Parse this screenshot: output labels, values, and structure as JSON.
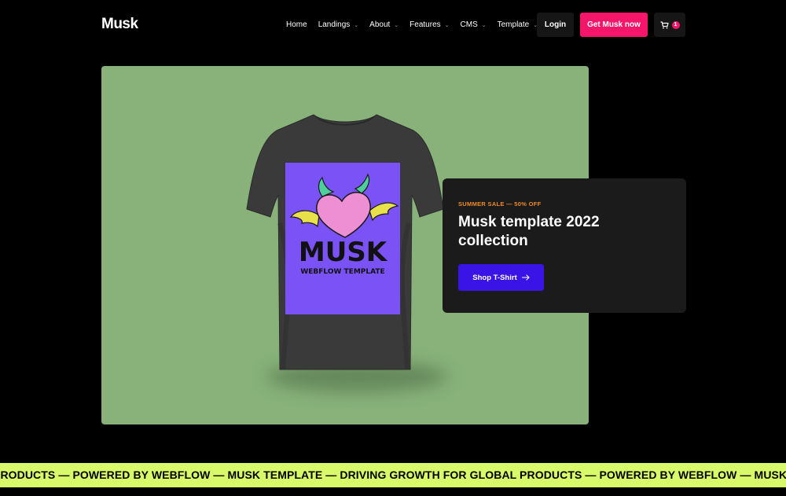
{
  "header": {
    "logo": "Musk",
    "nav": [
      {
        "label": "Home",
        "dropdown": false
      },
      {
        "label": "Landings",
        "dropdown": true
      },
      {
        "label": "About",
        "dropdown": true
      },
      {
        "label": "Features",
        "dropdown": true
      },
      {
        "label": "CMS",
        "dropdown": true
      },
      {
        "label": "Template",
        "dropdown": true
      }
    ],
    "login_label": "Login",
    "cta_label": "Get Musk now",
    "cart_count": "1"
  },
  "hero": {
    "background_color": "#88b27a",
    "shirt_print": {
      "title": "MUSK",
      "subtitle": "WEBFLOW TEMPLATE",
      "print_color": "#7a52f5"
    }
  },
  "promo": {
    "tag": "SUMMER SALE — 50% OFF",
    "title": "Musk template 2022 collection",
    "button_label": "Shop T-Shirt",
    "button_icon": "arrow-right-icon"
  },
  "ticker": {
    "text": "PRODUCTS — POWERED BY WEBFLOW — MUSK TEMPLATE — DRIVING GROWTH FOR GLOBAL PRODUCTS — POWERED BY WEBFLOW — MUSK TEMPLATE — DRIVING GROWTH FOR GLOBAL PRODUCTS",
    "background_color": "#d7f96a"
  },
  "colors": {
    "accent_pink": "#f5166a",
    "accent_blue": "#3a14e6",
    "tag_orange": "#f08a24"
  }
}
